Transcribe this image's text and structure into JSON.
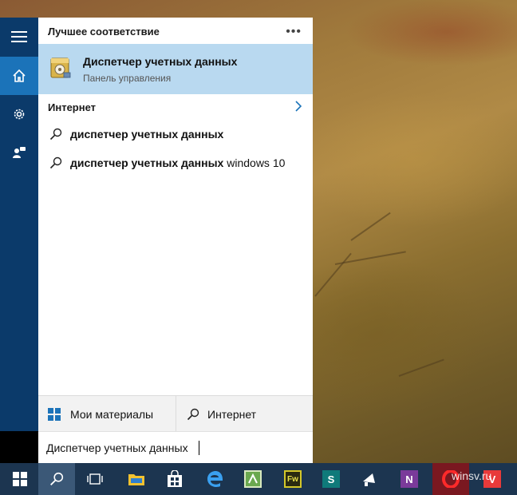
{
  "panel": {
    "best_match_title": "Лучшее соответствие",
    "more_icon": "ellipsis-icon",
    "best_match": {
      "title": "Диспетчер учетных данных",
      "subtitle": "Панель управления",
      "icon": "credential-manager-icon"
    },
    "internet_title": "Интернет",
    "suggestions": [
      {
        "bold": "диспетчер учетных данных",
        "rest": ""
      },
      {
        "bold": "диспетчер учетных данных",
        "rest": " windows 10"
      }
    ]
  },
  "rail": {
    "items": [
      "hamburger-icon",
      "home-icon",
      "settings-icon",
      "feedback-icon"
    ]
  },
  "filters": {
    "my_stuff": "Мои материалы",
    "web": "Интернет"
  },
  "search": {
    "value": "Диспетчер учетных данных"
  },
  "taskbar": {
    "items": [
      "start-icon",
      "search-icon",
      "task-view-icon",
      "file-explorer-icon",
      "store-icon",
      "edge-icon",
      "spreadsheet-app-icon",
      "fireworks-icon",
      "sway-icon",
      "announcement-app-icon",
      "onenote-icon",
      "opera-icon",
      "vivaldi-icon"
    ],
    "fireworks_label": "Fw"
  },
  "watermark": "winsv.ru",
  "colors": {
    "accent": "#1b73b9",
    "rail": "#0b3a6a",
    "selection": "#b9d9f0",
    "taskbar": "#1c3550"
  }
}
